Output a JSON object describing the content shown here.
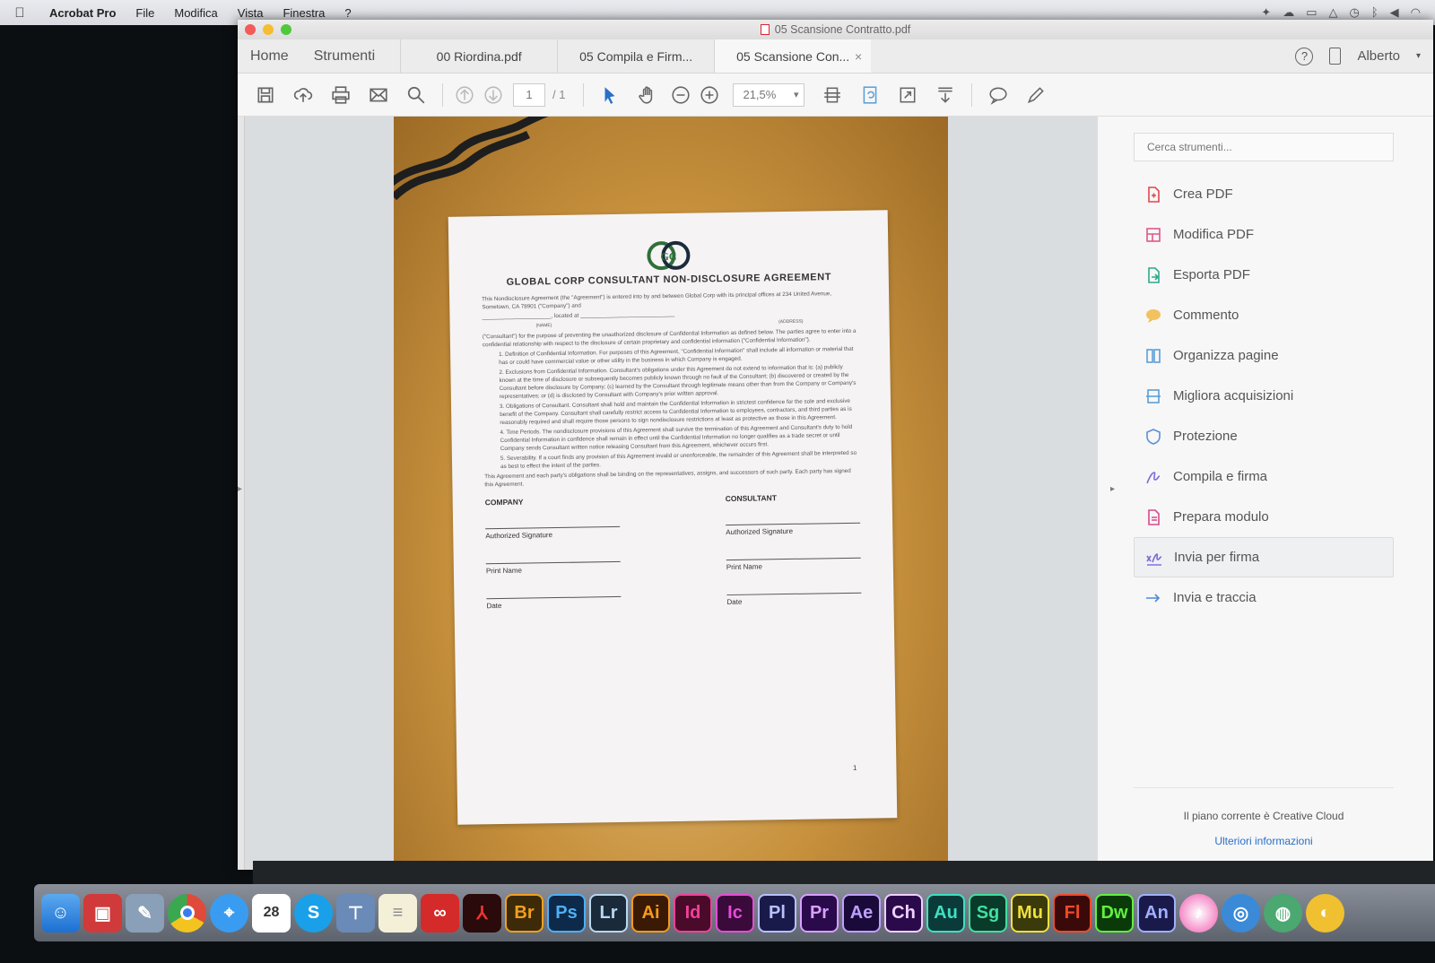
{
  "menubar": {
    "app": "Acrobat Pro",
    "items": [
      "File",
      "Modifica",
      "Vista",
      "Finestra",
      "?"
    ]
  },
  "window": {
    "title": "05 Scansione Contratto.pdf"
  },
  "tabs": {
    "home": "Home",
    "tools": "Strumenti",
    "docs": [
      {
        "label": "00 Riordina.pdf"
      },
      {
        "label": "05 Compila e Firm..."
      },
      {
        "label": "05 Scansione Con..."
      }
    ],
    "close": "×",
    "user": "Alberto",
    "help": "?"
  },
  "toolbar": {
    "page_current": "1",
    "page_total": "/ 1",
    "zoom": "21,5%"
  },
  "document": {
    "logo": "GC",
    "title": "GLOBAL CORP CONSULTANT NON-DISCLOSURE AGREEMENT",
    "intro": "This Nondisclosure Agreement (the \"Agreement\") is entered into by and between Global Corp with its principal offices at 234 United Avenue, Sometown, CA 78901 (\"Company\") and",
    "located_at": "______________________, located at ______________________________",
    "name_label": "(NAME)",
    "address_label": "(ADDRESS)",
    "purpose": "(\"Consultant\") for the purpose of preventing the unauthorized disclosure of Confidential Information as defined below. The parties agree to enter into a confidential relationship with respect to the disclosure of certain proprietary and confidential information (\"Confidential Information\").",
    "clauses": [
      "1. Definition of Confidential Information. For purposes of this Agreement, \"Confidential Information\" shall include all information or material that has or could have commercial value or other utility in the business in which Company is engaged.",
      "2. Exclusions from Confidential Information. Consultant's obligations under this Agreement do not extend to information that is: (a) publicly known at the time of disclosure or subsequently becomes publicly known through no fault of the Consultant; (b) discovered or created by the Consultant before disclosure by Company; (c) learned by the Consultant through legitimate means other than from the Company or Company's representatives; or (d) is disclosed by Consultant with Company's prior written approval.",
      "3. Obligations of Consultant. Consultant shall hold and maintain the Confidential Information in strictest confidence for the sole and exclusive benefit of the Company. Consultant shall carefully restrict access to Confidential Information to employees, contractors, and third parties as is reasonably required and shall require those persons to sign nondisclosure restrictions at least as protective as those in this Agreement.",
      "4. Time Periods. The nondisclosure provisions of this Agreement shall survive the termination of this Agreement and Consultant's duty to hold Confidential Information in confidence shall remain in effect until the Confidential Information no longer qualifies as a trade secret or until Company sends Consultant written notice releasing Consultant from this Agreement, whichever occurs first.",
      "5. Severability. If a court finds any provision of this Agreement invalid or unenforceable, the remainder of this Agreement shall be interpreted so as best to effect the intent of the parties."
    ],
    "closing": "This Agreement and each party's obligations shall be binding on the representatives, assigns, and successors of such party. Each party has signed this Agreement.",
    "company": "COMPANY",
    "consultant": "CONSULTANT",
    "authorized_signature": "Authorized Signature",
    "print_name": "Print Name",
    "date": "Date",
    "page_number": "1"
  },
  "right_pane": {
    "search_placeholder": "Cerca strumenti...",
    "tools": [
      {
        "label": "Crea PDF",
        "icon": "create-pdf-icon",
        "color": "#e0474c"
      },
      {
        "label": "Modifica PDF",
        "icon": "edit-pdf-icon",
        "color": "#e0578a"
      },
      {
        "label": "Esporta PDF",
        "icon": "export-pdf-icon",
        "color": "#2fa88a"
      },
      {
        "label": "Commento",
        "icon": "comment-icon",
        "color": "#f0b43a"
      },
      {
        "label": "Organizza pagine",
        "icon": "organize-pages-icon",
        "color": "#5b9fd8"
      },
      {
        "label": "Migliora acquisizioni",
        "icon": "enhance-scans-icon",
        "color": "#5b9fd8"
      },
      {
        "label": "Protezione",
        "icon": "protect-icon",
        "color": "#5b8fd8"
      },
      {
        "label": "Compila e firma",
        "icon": "fill-sign-icon",
        "color": "#7d6ad8"
      },
      {
        "label": "Prepara modulo",
        "icon": "prepare-form-icon",
        "color": "#d84a8a"
      },
      {
        "label": "Invia per firma",
        "icon": "send-sign-icon",
        "color": "#7d6ad8"
      },
      {
        "label": "Invia e traccia",
        "icon": "send-track-icon",
        "color": "#4a8ad8"
      }
    ],
    "active_index": 9,
    "plan_text": "Il piano corrente è Creative Cloud",
    "plan_link": "Ulteriori informazioni"
  },
  "dock": {
    "calendar_day": "28",
    "apps": [
      {
        "label": "Br",
        "bg": "#3d2a08",
        "fg": "#f0a020"
      },
      {
        "label": "Ps",
        "bg": "#0e2a4a",
        "fg": "#4db0f5"
      },
      {
        "label": "Lr",
        "bg": "#1a2a3a",
        "fg": "#b8d8f0"
      },
      {
        "label": "Ai",
        "bg": "#3a1a05",
        "fg": "#f79a1c"
      },
      {
        "label": "Id",
        "bg": "#4a0a2a",
        "fg": "#f0419a"
      },
      {
        "label": "Ic",
        "bg": "#3a0a3a",
        "fg": "#e64cd8"
      },
      {
        "label": "Pl",
        "bg": "#1a1a4a",
        "fg": "#b8c0ff"
      },
      {
        "label": "Pr",
        "bg": "#2a0a4a",
        "fg": "#d7a0ff"
      },
      {
        "label": "Ae",
        "bg": "#1a0a3a",
        "fg": "#c0a0ff"
      },
      {
        "label": "Ch",
        "bg": "#2a0a4a",
        "fg": "#f0d0ff"
      },
      {
        "label": "Au",
        "bg": "#0a3a3a",
        "fg": "#40e0c0"
      },
      {
        "label": "Sg",
        "bg": "#0a3a2a",
        "fg": "#40e0a0"
      },
      {
        "label": "Mu",
        "bg": "#3a3a0a",
        "fg": "#f0e040"
      },
      {
        "label": "Fl",
        "bg": "#3a0a0a",
        "fg": "#f04a2a"
      },
      {
        "label": "Dw",
        "bg": "#0a3a0a",
        "fg": "#60f040"
      },
      {
        "label": "An",
        "bg": "#1a1a4a",
        "fg": "#a0b0ff"
      }
    ]
  }
}
